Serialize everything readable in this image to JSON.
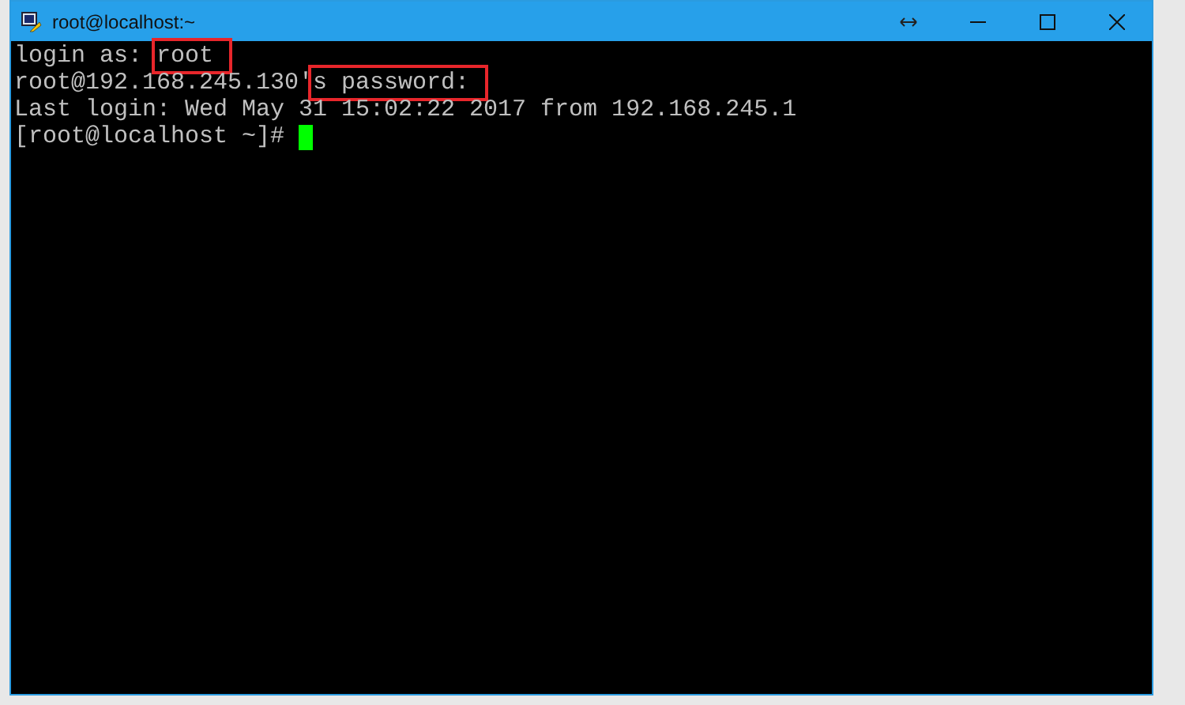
{
  "window": {
    "title": "root@localhost:~"
  },
  "terminal": {
    "lines": [
      {
        "segments": [
          {
            "text": "login as: ",
            "highlighted": false
          },
          {
            "text": "root",
            "highlighted": true
          }
        ]
      },
      {
        "segments": [
          {
            "text": "root@192.168.245.130'",
            "highlighted": false
          },
          {
            "text": "s password:",
            "highlighted": true
          }
        ]
      },
      {
        "segments": [
          {
            "text": "Last login: Wed May 31 15:02:22 2017 from 192.168.245.1",
            "highlighted": false
          }
        ]
      },
      {
        "segments": [
          {
            "text": "[root@localhost ~]# ",
            "highlighted": false
          }
        ],
        "cursor": true
      }
    ]
  }
}
